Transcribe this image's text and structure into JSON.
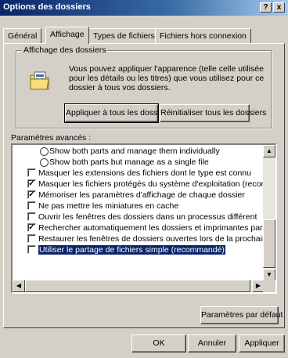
{
  "window": {
    "title": "Options des dossiers",
    "help_label": "?",
    "close_label": "x"
  },
  "tabs": [
    {
      "label": "Général",
      "active": false
    },
    {
      "label": "Affichage",
      "active": true
    },
    {
      "label": "Types de fichiers",
      "active": false
    },
    {
      "label": "Fichiers hors connexion",
      "active": false
    }
  ],
  "folder_view": {
    "legend": "Affichage des dossiers",
    "description": "Vous pouvez appliquer l'apparence (telle celle utilisée pour les détails ou les titres) que vous utilisez pour ce dossier à tous vos dossiers.",
    "apply_all_label": "Appliquer à tous les dossiers",
    "reset_all_label": "Réinitialiser tous les dossiers"
  },
  "advanced": {
    "label": "Paramètres avancés :",
    "items": [
      {
        "type": "radio",
        "label": "Show both parts and manage them individually",
        "checked": false
      },
      {
        "type": "radio",
        "label": "Show both parts but manage as a single file",
        "checked": false
      },
      {
        "type": "checkbox",
        "label": "Masquer les extensions des fichiers dont le type est connu",
        "checked": false
      },
      {
        "type": "checkbox",
        "label": "Masquer les fichiers protégés du système d'exploitation (recommandé)",
        "checked": true
      },
      {
        "type": "checkbox",
        "label": "Mémoriser les paramètres d'affichage de chaque dossier",
        "checked": true
      },
      {
        "type": "checkbox",
        "label": "Ne pas mettre les miniatures en cache",
        "checked": false
      },
      {
        "type": "checkbox",
        "label": "Ouvrir les fenêtres des dossiers dans un processus différent",
        "checked": false
      },
      {
        "type": "checkbox",
        "label": "Rechercher automatiquement les dossiers et imprimantes partagés",
        "checked": true
      },
      {
        "type": "checkbox",
        "label": "Restaurer les fenêtres de dossiers ouvertes lors de la prochaine ouverture",
        "checked": false
      },
      {
        "type": "checkbox",
        "label": "Utiliser le partage de fichiers simple (recommandé)",
        "checked": false,
        "selected": true
      }
    ]
  },
  "buttons": {
    "defaults_label": "Paramètres par défaut",
    "ok_label": "OK",
    "cancel_label": "Annuler",
    "apply_label": "Appliquer"
  },
  "icons": {
    "folder": "folder-options-icon",
    "scroll_up": "arrow-up-icon",
    "scroll_down": "arrow-down-icon",
    "scroll_left": "arrow-left-icon",
    "scroll_right": "arrow-right-icon"
  }
}
